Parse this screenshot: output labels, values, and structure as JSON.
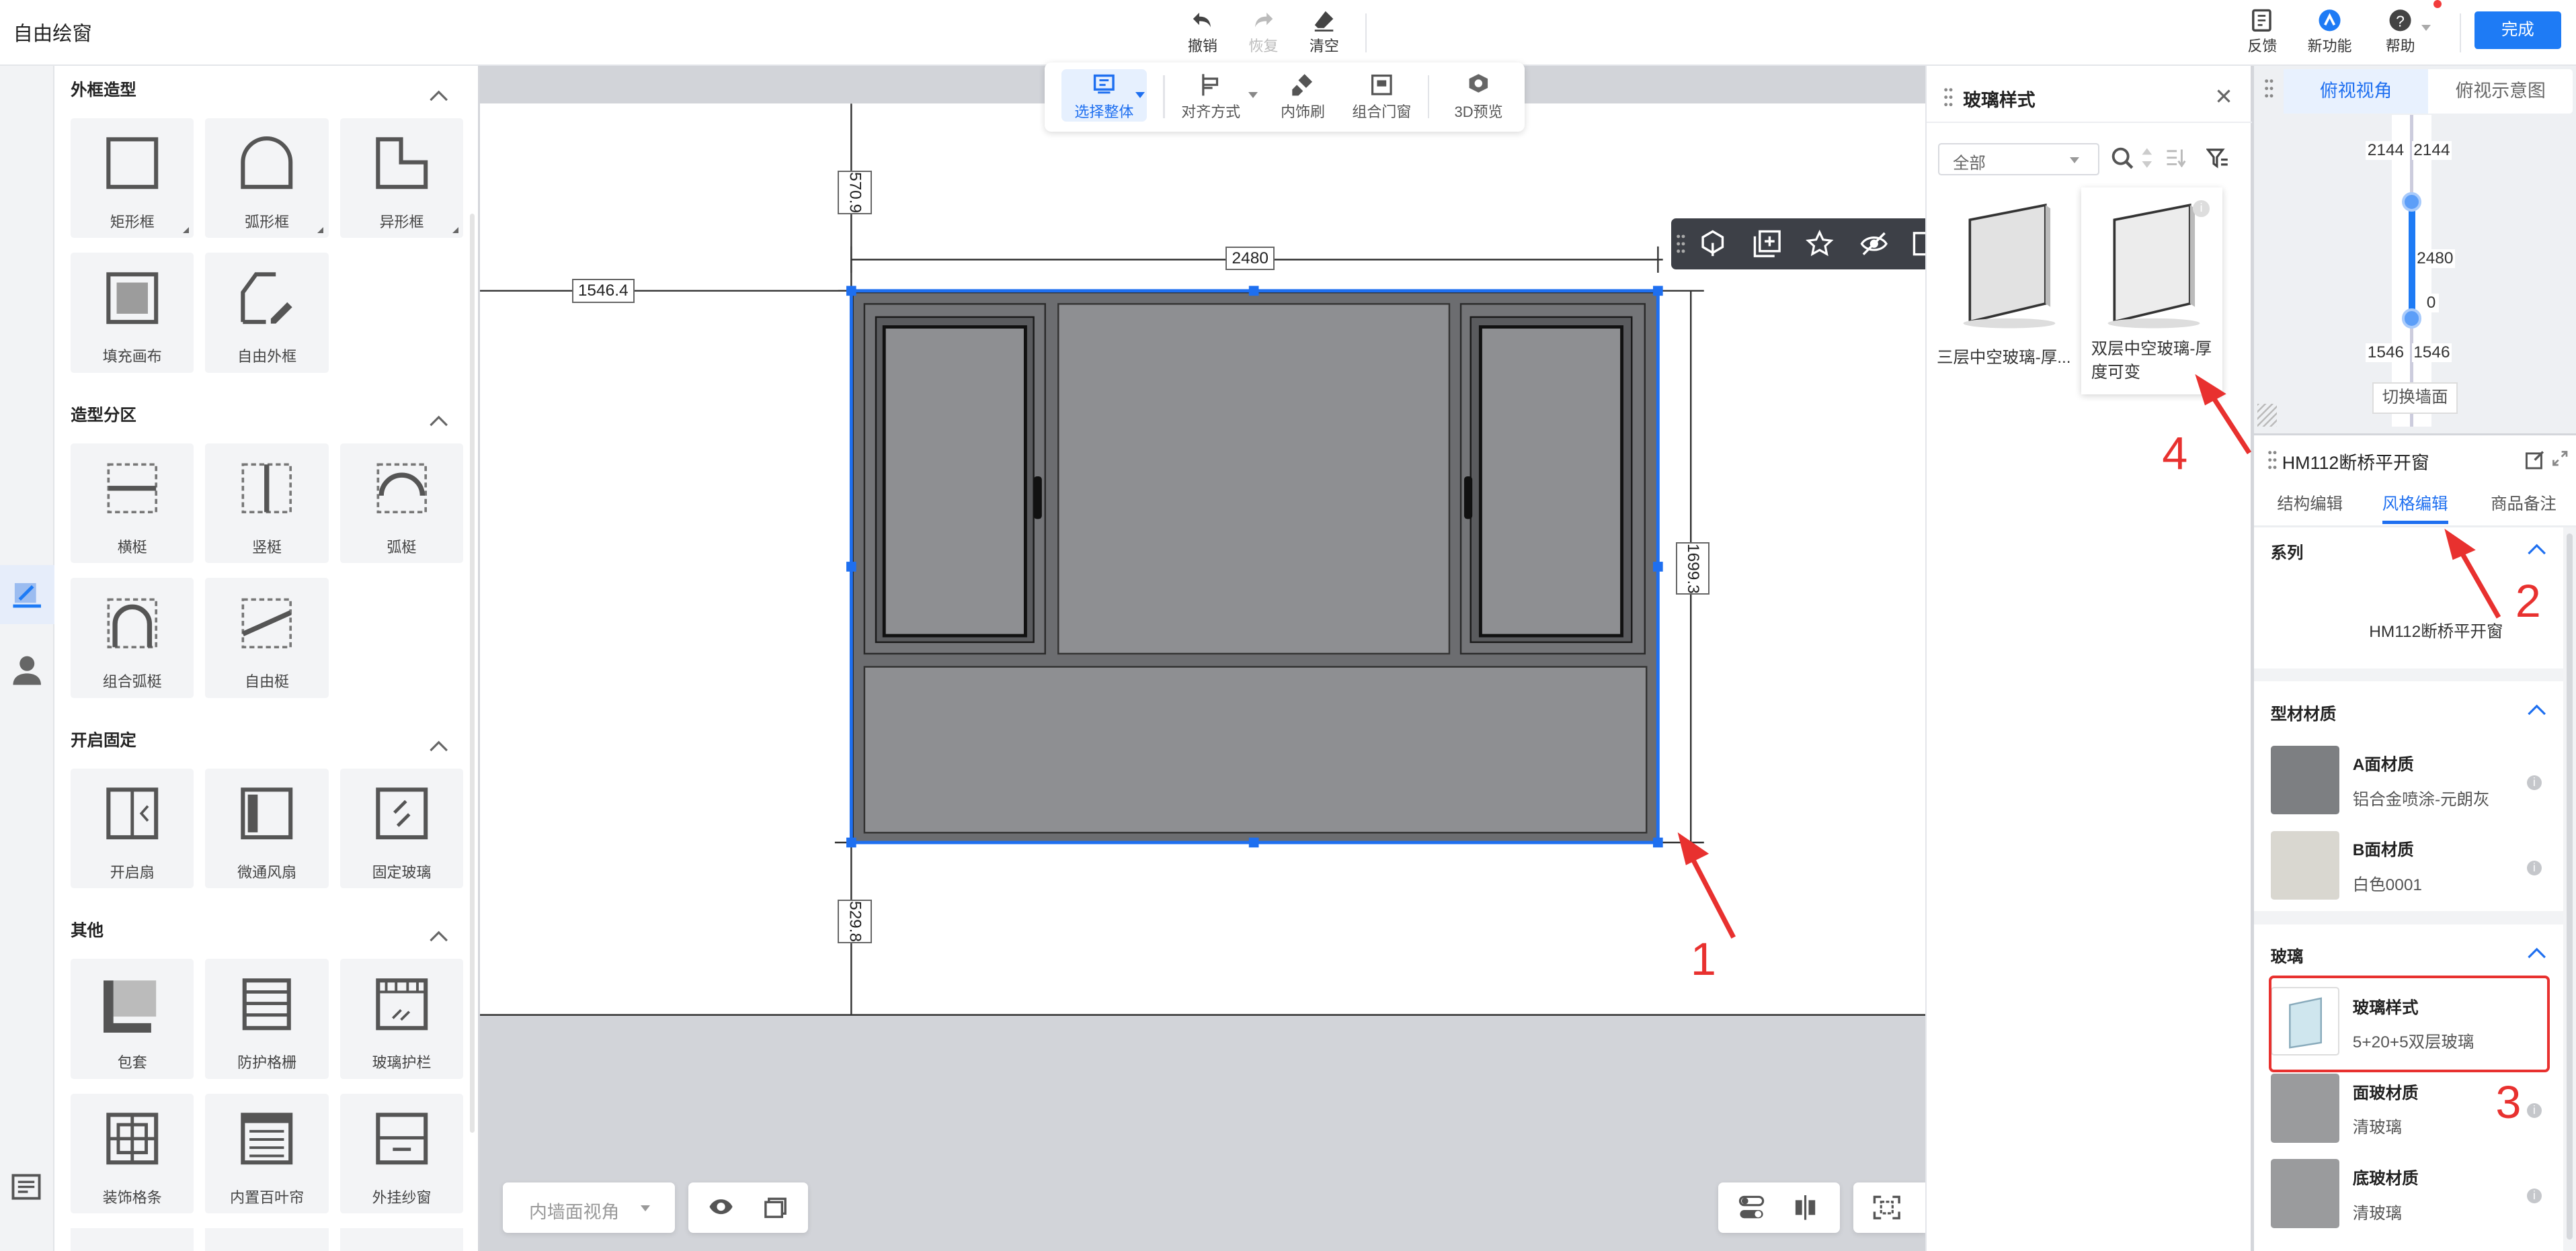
{
  "app": {
    "title": "自由绘窗"
  },
  "toolbar": {
    "undo": "撤销",
    "redo": "恢复",
    "clear": "清空",
    "feedback": "反馈",
    "new_features": "新功能",
    "help": "帮助",
    "done": "完成"
  },
  "library": {
    "sections": [
      {
        "title": "外框造型",
        "items": [
          "矩形框",
          "弧形框",
          "异形框",
          "填充画布",
          "自由外框"
        ]
      },
      {
        "title": "造型分区",
        "items": [
          "横梃",
          "竖梃",
          "弧梃",
          "组合弧梃",
          "自由梃"
        ]
      },
      {
        "title": "开启固定",
        "items": [
          "开启扇",
          "微通风扇",
          "固定玻璃"
        ]
      },
      {
        "title": "其他",
        "items": [
          "包套",
          "防护格栅",
          "玻璃护栏",
          "装饰格条",
          "内置百叶帘",
          "外挂纱窗"
        ]
      }
    ]
  },
  "canvas_toolbar": {
    "select_all": "选择整体",
    "align": "对齐方式",
    "trim_brush": "内饰刷",
    "combo": "组合门窗",
    "preview3d": "3D预览"
  },
  "dimensions": {
    "top_height": "570.9",
    "left_offset": "1546.4",
    "width": "2480",
    "height": "1699.3",
    "bottom_height": "529.8"
  },
  "bottom_bar": {
    "view_select": "内墙面视角"
  },
  "glass_panel": {
    "title": "玻璃样式",
    "filter": "全部",
    "items": [
      {
        "label": "三层中空玻璃-厚..."
      },
      {
        "label": "双层中空玻璃-厚度可变"
      }
    ]
  },
  "minimap": {
    "tabs": [
      "俯视视角",
      "俯视示意图"
    ],
    "values": {
      "top_left": "2144",
      "top_right": "2144",
      "mid": "2480",
      "zero": "0",
      "bottom_left": "1546",
      "bottom_right": "1546"
    },
    "switch_wall": "切换墙面"
  },
  "props": {
    "title": "HM112断桥平开窗",
    "tabs": [
      "结构编辑",
      "风格编辑",
      "商品备注"
    ],
    "series_label": "系列",
    "series_value": "HM112断桥平开窗",
    "material_label": "型材材质",
    "a_face": {
      "title": "A面材质",
      "value": "铝合金喷涂-元朗灰",
      "color": "#7d7f82"
    },
    "b_face": {
      "title": "B面材质",
      "value": "白色0001",
      "color": "#d9d7d0"
    },
    "glass_label": "玻璃",
    "glass_style": {
      "title": "玻璃样式",
      "value": "5+20+5双层玻璃"
    },
    "face_glass": {
      "title": "面玻材质",
      "value": "清玻璃",
      "color": "#9a9b9d"
    },
    "bottom_glass": {
      "title": "底玻材质",
      "value": "清玻璃",
      "color": "#9a9b9d"
    }
  },
  "annotations": {
    "n1": "1",
    "n2": "2",
    "n3": "3",
    "n4": "4"
  },
  "colors": {
    "accent": "#1e7bf5",
    "annotation": "#e8312f",
    "frame": "#6c6d70",
    "glass": "#8e8f92"
  }
}
